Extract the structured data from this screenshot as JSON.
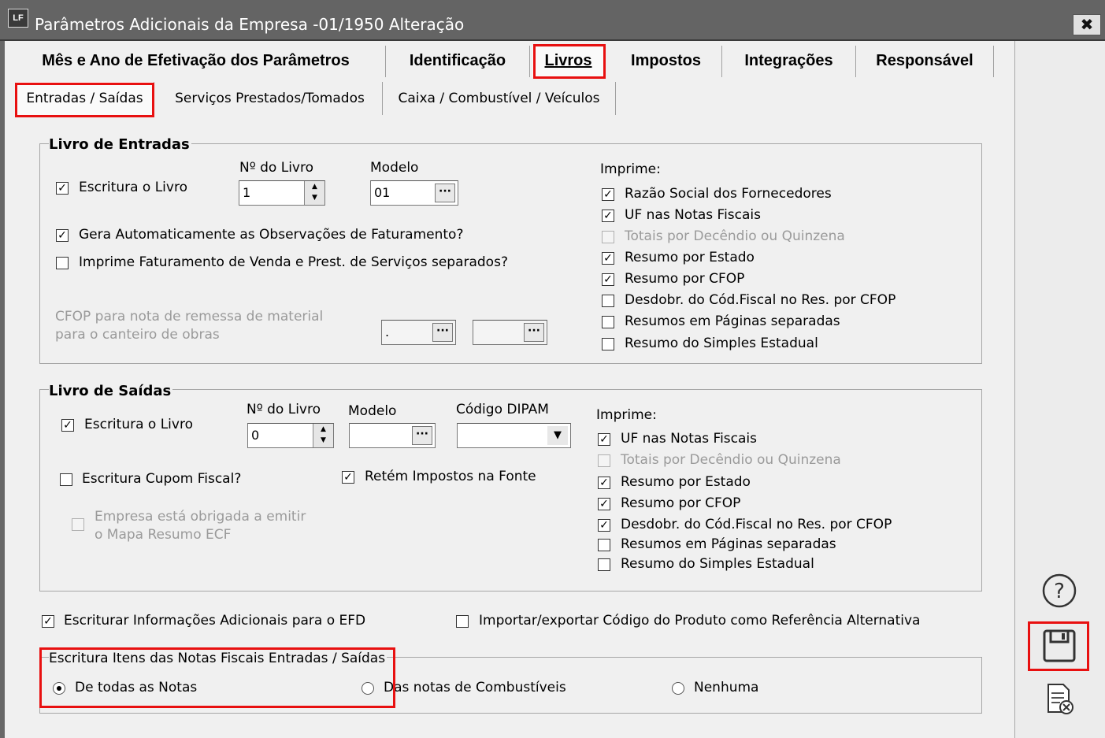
{
  "window": {
    "app_icon": "LF",
    "title": "Parâmetros Adicionais da Empresa -01/1950 Alteração",
    "close": "✖"
  },
  "tabs": [
    "Mês e Ano de Efetivação dos Parâmetros",
    "Identificação",
    "Livros",
    "Impostos",
    "Integrações",
    "Responsável"
  ],
  "subtabs": [
    "Entradas / Saídas",
    "Serviços Prestados/Tomados",
    "Caixa / Combustível / Veículos"
  ],
  "entradas": {
    "group_title": "Livro de Entradas",
    "escritura": "Escritura o Livro",
    "numero_label": "Nº do Livro",
    "numero_value": "1",
    "modelo_label": "Modelo",
    "modelo_value": "01",
    "gera_obs": "Gera Automaticamente as Observações de Faturamento?",
    "imprime_fat": "Imprime Faturamento de Venda e Prest. de Serviços separados?",
    "cfop_line1": "CFOP para nota de remessa de material",
    "cfop_line2": "para o canteiro de obras",
    "cfop_value1": ".",
    "cfop_value2": "",
    "imprime_label": "Imprime:",
    "imprime": [
      "Razão Social dos Fornecedores",
      "UF nas Notas Fiscais",
      "Totais por Decêndio ou Quinzena",
      "Resumo por Estado",
      "Resumo por CFOP",
      "Desdobr. do Cód.Fiscal no Res. por CFOP",
      "Resumos em Páginas separadas",
      "Resumo do Simples Estadual"
    ]
  },
  "saidas": {
    "group_title": "Livro de Saídas",
    "escritura": "Escritura o Livro",
    "numero_label": "Nº do Livro",
    "numero_value": "0",
    "modelo_label": "Modelo",
    "modelo_value": "",
    "dipam_label": "Código DIPAM",
    "dipam_value": "",
    "cupom": "Escritura Cupom Fiscal?",
    "retem": "Retém Impostos na Fonte",
    "mapa_line1": "Empresa está obrigada a emitir",
    "mapa_line2": "o Mapa Resumo ECF",
    "imprime_label": "Imprime:",
    "imprime": [
      "UF nas Notas Fiscais",
      "Totais por Decêndio ou Quinzena",
      "Resumo por Estado",
      "Resumo por CFOP",
      "Desdobr. do Cód.Fiscal no Res. por CFOP",
      "Resumos em Páginas separadas",
      "Resumo do Simples Estadual"
    ]
  },
  "efd": "Escriturar Informações Adicionais para o EFD",
  "importar": "Importar/exportar Código do Produto como Referência Alternativa",
  "itens": {
    "group_title": "Escritura Itens das Notas Fiscais Entradas / Saídas",
    "options": [
      "De todas as Notas",
      "Das notas de Combustíveis",
      "Nenhuma"
    ]
  },
  "sidebar_icons": [
    "help-icon",
    "save-icon",
    "cancel-document-icon"
  ]
}
